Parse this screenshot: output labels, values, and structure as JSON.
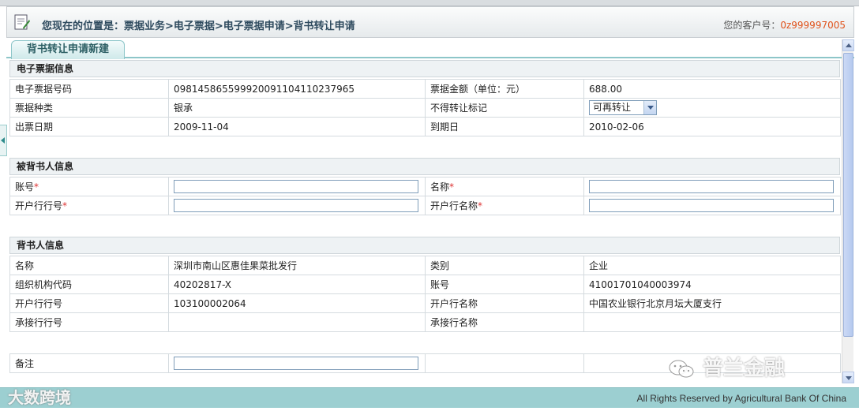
{
  "header": {
    "location_label": "您现在的位置是：",
    "location_path": "票据业务>电子票据>电子票据申请>背书转让申请",
    "customer_label": "您的客户号：",
    "customer_no": "0z999997005"
  },
  "tab": {
    "label": "背书转让申请新建"
  },
  "bill_info": {
    "title": "电子票据信息",
    "bill_no_label": "电子票据号码",
    "bill_no": "098145865599920091104110237965",
    "amount_label": "票据金额（单位：元）",
    "amount": "688.00",
    "type_label": "票据种类",
    "type": "银承",
    "nontransfer_label": "不得转让标记",
    "nontransfer_value": "可再转让",
    "issue_date_label": "出票日期",
    "issue_date": "2009-11-04",
    "due_date_label": "到期日",
    "due_date": "2010-02-06"
  },
  "endorsee": {
    "title": "被背书人信息",
    "account_label": "账号",
    "name_label": "名称",
    "bank_no_label": "开户行行号",
    "bank_name_label": "开户行名称",
    "required_mark": "*"
  },
  "endorser": {
    "title": "背书人信息",
    "name_label": "名称",
    "name": "深圳市南山区惠佳果菜批发行",
    "category_label": "类别",
    "category": "企业",
    "org_code_label": "组织机构代码",
    "org_code": "40202817-X",
    "account_label": "账号",
    "account": "41001701040003974",
    "bank_no_label": "开户行行号",
    "bank_no": "103100002064",
    "bank_name_label": "开户行名称",
    "bank_name": "中国农业银行北京月坛大厦支行",
    "acceptor_no_label": "承接行行号",
    "acceptor_name_label": "承接行名称"
  },
  "remark": {
    "label": "备注"
  },
  "footer": {
    "copyright": "All Rights Reserved by Agricultural Bank Of China"
  },
  "watermarks": {
    "bottom_left": "大数跨境",
    "right": "普兰金融"
  },
  "colors": {
    "accent_teal": "#9ccfd1",
    "customer_no": "#e0521b",
    "required": "#dd3333"
  }
}
